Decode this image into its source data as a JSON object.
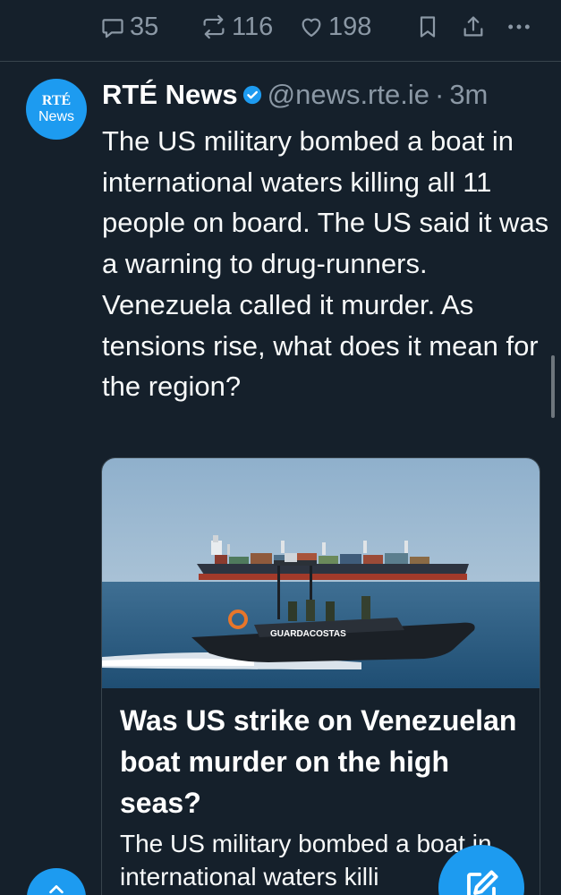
{
  "actions": {
    "replies": "35",
    "retweets": "116",
    "likes": "198"
  },
  "tweet": {
    "avatar_line1": "RTÉ",
    "avatar_line2": "News",
    "name": "RTÉ News",
    "handle": "@news.rte.ie",
    "separator": "·",
    "time": "3m",
    "text": "The US military bombed a boat in international waters killing all 11 people on board. The US said it was a warning to drug-runners. Venezuela called it murder. As tensions rise, what does it mean for the region?"
  },
  "card": {
    "image_label": "GUARDACOSTAS",
    "title": "Was US strike on Venezuelan boat murder on the high seas?",
    "description": "The US military bombed a boat in international waters killi"
  },
  "colors": {
    "background": "#15202b",
    "accent": "#1d9bf0",
    "muted": "#8b98a5",
    "border": "#38444d"
  },
  "icons": [
    "reply-icon",
    "retweet-icon",
    "heart-icon",
    "bookmark-icon",
    "share-icon",
    "more-icon",
    "verified-icon",
    "compose-icon",
    "scroll-up-icon"
  ]
}
